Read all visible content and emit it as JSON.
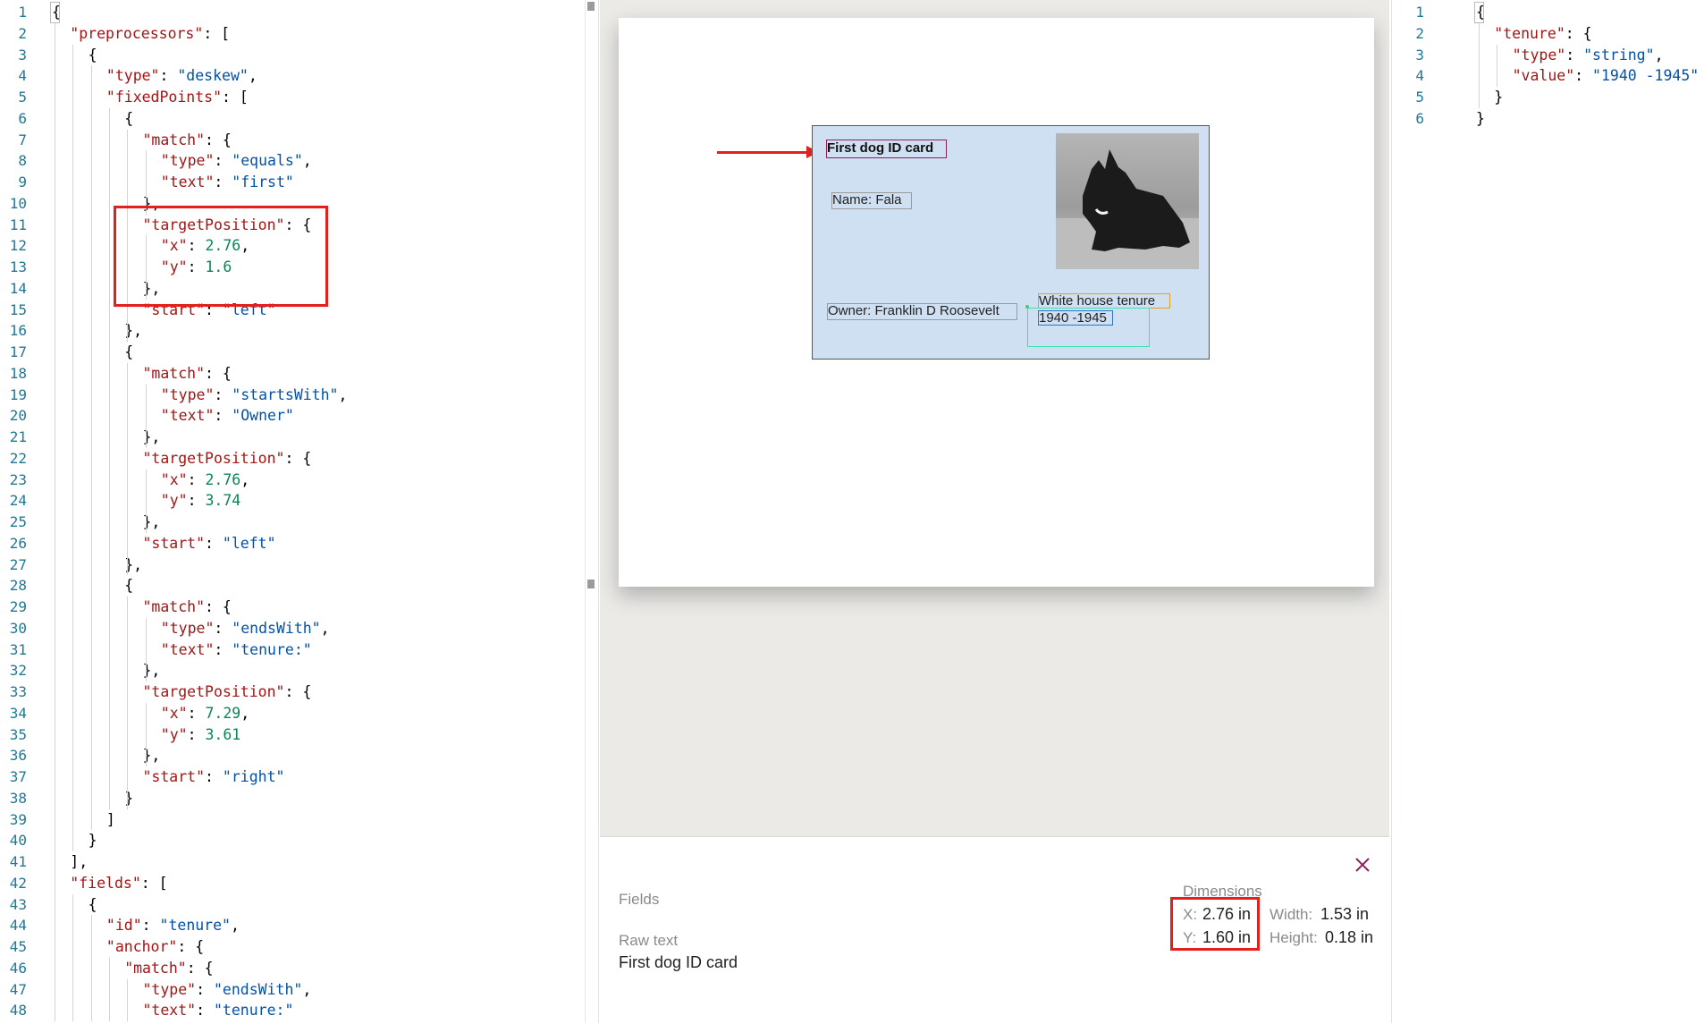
{
  "left_editor": {
    "line_numbers": [
      "1",
      "2",
      "3",
      "4",
      "5",
      "6",
      "7",
      "8",
      "9",
      "10",
      "11",
      "12",
      "13",
      "14",
      "15",
      "16",
      "17",
      "18",
      "19",
      "20",
      "21",
      "22",
      "23",
      "24",
      "25",
      "26",
      "27",
      "28",
      "29",
      "30",
      "31",
      "32",
      "33",
      "34",
      "35",
      "36",
      "37",
      "38",
      "39",
      "40",
      "41",
      "42",
      "43",
      "44",
      "45",
      "46",
      "47",
      "48"
    ],
    "lines": [
      [
        [
          "p",
          "{"
        ]
      ],
      [
        [
          "k",
          "\"preprocessors\""
        ],
        [
          "p",
          ": ["
        ]
      ],
      [
        [
          "p",
          "{"
        ]
      ],
      [
        [
          "k",
          "\"type\""
        ],
        [
          "p",
          ": "
        ],
        [
          "s",
          "\"deskew\""
        ],
        [
          "p",
          ","
        ]
      ],
      [
        [
          "k",
          "\"fixedPoints\""
        ],
        [
          "p",
          ": ["
        ]
      ],
      [
        [
          "p",
          "{"
        ]
      ],
      [
        [
          "k",
          "\"match\""
        ],
        [
          "p",
          ": {"
        ]
      ],
      [
        [
          "k",
          "\"type\""
        ],
        [
          "p",
          ": "
        ],
        [
          "s",
          "\"equals\""
        ],
        [
          "p",
          ","
        ]
      ],
      [
        [
          "k",
          "\"text\""
        ],
        [
          "p",
          ": "
        ],
        [
          "s",
          "\"first\""
        ]
      ],
      [
        [
          "p",
          "},"
        ]
      ],
      [
        [
          "k",
          "\"targetPosition\""
        ],
        [
          "p",
          ": {"
        ]
      ],
      [
        [
          "k",
          "\"x\""
        ],
        [
          "p",
          ": "
        ],
        [
          "n",
          "2.76"
        ],
        [
          "p",
          ","
        ]
      ],
      [
        [
          "k",
          "\"y\""
        ],
        [
          "p",
          ": "
        ],
        [
          "n",
          "1.6"
        ]
      ],
      [
        [
          "p",
          "},"
        ]
      ],
      [
        [
          "k",
          "\"start\""
        ],
        [
          "p",
          ": "
        ],
        [
          "s",
          "\"left\""
        ]
      ],
      [
        [
          "p",
          "},"
        ]
      ],
      [
        [
          "p",
          "{"
        ]
      ],
      [
        [
          "k",
          "\"match\""
        ],
        [
          "p",
          ": {"
        ]
      ],
      [
        [
          "k",
          "\"type\""
        ],
        [
          "p",
          ": "
        ],
        [
          "s",
          "\"startsWith\""
        ],
        [
          "p",
          ","
        ]
      ],
      [
        [
          "k",
          "\"text\""
        ],
        [
          "p",
          ": "
        ],
        [
          "s",
          "\"Owner\""
        ]
      ],
      [
        [
          "p",
          "},"
        ]
      ],
      [
        [
          "k",
          "\"targetPosition\""
        ],
        [
          "p",
          ": {"
        ]
      ],
      [
        [
          "k",
          "\"x\""
        ],
        [
          "p",
          ": "
        ],
        [
          "n",
          "2.76"
        ],
        [
          "p",
          ","
        ]
      ],
      [
        [
          "k",
          "\"y\""
        ],
        [
          "p",
          ": "
        ],
        [
          "n",
          "3.74"
        ]
      ],
      [
        [
          "p",
          "},"
        ]
      ],
      [
        [
          "k",
          "\"start\""
        ],
        [
          "p",
          ": "
        ],
        [
          "s",
          "\"left\""
        ]
      ],
      [
        [
          "p",
          "},"
        ]
      ],
      [
        [
          "p",
          "{"
        ]
      ],
      [
        [
          "k",
          "\"match\""
        ],
        [
          "p",
          ": {"
        ]
      ],
      [
        [
          "k",
          "\"type\""
        ],
        [
          "p",
          ": "
        ],
        [
          "s",
          "\"endsWith\""
        ],
        [
          "p",
          ","
        ]
      ],
      [
        [
          "k",
          "\"text\""
        ],
        [
          "p",
          ": "
        ],
        [
          "s",
          "\"tenure:\""
        ]
      ],
      [
        [
          "p",
          "},"
        ]
      ],
      [
        [
          "k",
          "\"targetPosition\""
        ],
        [
          "p",
          ": {"
        ]
      ],
      [
        [
          "k",
          "\"x\""
        ],
        [
          "p",
          ": "
        ],
        [
          "n",
          "7.29"
        ],
        [
          "p",
          ","
        ]
      ],
      [
        [
          "k",
          "\"y\""
        ],
        [
          "p",
          ": "
        ],
        [
          "n",
          "3.61"
        ]
      ],
      [
        [
          "p",
          "},"
        ]
      ],
      [
        [
          "k",
          "\"start\""
        ],
        [
          "p",
          ": "
        ],
        [
          "s",
          "\"right\""
        ]
      ],
      [
        [
          "p",
          "}"
        ]
      ],
      [
        [
          "p",
          "]"
        ]
      ],
      [
        [
          "p",
          "}"
        ]
      ],
      [
        [
          "p",
          "],"
        ]
      ],
      [
        [
          "k",
          "\"fields\""
        ],
        [
          "p",
          ": ["
        ]
      ],
      [
        [
          "p",
          "{"
        ]
      ],
      [
        [
          "k",
          "\"id\""
        ],
        [
          "p",
          ": "
        ],
        [
          "s",
          "\"tenure\""
        ],
        [
          "p",
          ","
        ]
      ],
      [
        [
          "k",
          "\"anchor\""
        ],
        [
          "p",
          ": {"
        ]
      ],
      [
        [
          "k",
          "\"match\""
        ],
        [
          "p",
          ": {"
        ]
      ],
      [
        [
          "k",
          "\"type\""
        ],
        [
          "p",
          ": "
        ],
        [
          "s",
          "\"endsWith\""
        ],
        [
          "p",
          ","
        ]
      ],
      [
        [
          "k",
          "\"text\""
        ],
        [
          "p",
          ": "
        ],
        [
          "s",
          "\"tenure:\""
        ]
      ]
    ]
  },
  "right_editor": {
    "line_numbers": [
      "1",
      "2",
      "3",
      "4",
      "5",
      "6"
    ],
    "lines": [
      [
        [
          "p",
          "{"
        ]
      ],
      [
        [
          "k",
          "\"tenure\""
        ],
        [
          "p",
          ": {"
        ]
      ],
      [
        [
          "k",
          "\"type\""
        ],
        [
          "p",
          ": "
        ],
        [
          "s",
          "\"string\""
        ],
        [
          "p",
          ","
        ]
      ],
      [
        [
          "k",
          "\"value\""
        ],
        [
          "p",
          ": "
        ],
        [
          "s",
          "\"1940 -1945\""
        ]
      ],
      [
        [
          "p",
          "}"
        ]
      ],
      [
        [
          "p",
          "}"
        ]
      ]
    ]
  },
  "document": {
    "card_title": "First dog ID card",
    "name_line": "Name: Fala",
    "owner_line": "Owner: Franklin D Roosevelt",
    "tenure_label": "White house tenure",
    "tenure_value": "1940 -1945"
  },
  "details": {
    "fields_label": "Fields",
    "raw_text_label": "Raw text",
    "raw_text_value": "First dog ID card",
    "dimensions_label": "Dimensions",
    "x_label": "X:",
    "x_value": "2.76 in",
    "y_label": "Y:",
    "y_value": "1.60 in",
    "width_label": "Width:",
    "width_value": "1.53 in",
    "height_label": "Height:",
    "height_value": "0.18 in"
  },
  "colors": {
    "annotation_red": "#e3201b",
    "json_key": "#a31515",
    "json_string": "#0451a5",
    "json_number": "#098658",
    "line_number": "#237893",
    "card_background": "#cfe0f3"
  }
}
